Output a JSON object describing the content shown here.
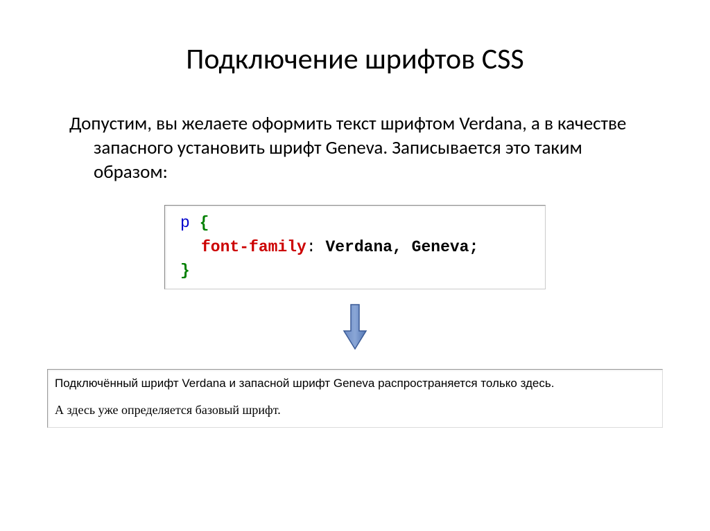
{
  "title": "Подключение шрифтов CSS",
  "body_text": "Допустим, вы желаете оформить текст шрифтом Verdana, а в качестве запасного установить шрифт Geneva. Записывается это таким образом:",
  "code": {
    "selector": "p",
    "open_brace": "{",
    "property": "font-family",
    "colon": ":",
    "value": " Verdana, Geneva;",
    "close_brace": "}"
  },
  "output": {
    "line1": "Подключённый шрифт Verdana и запасной шрифт Geneva распространяется только здесь.",
    "line2": "А здесь уже определяется базовый шрифт."
  }
}
